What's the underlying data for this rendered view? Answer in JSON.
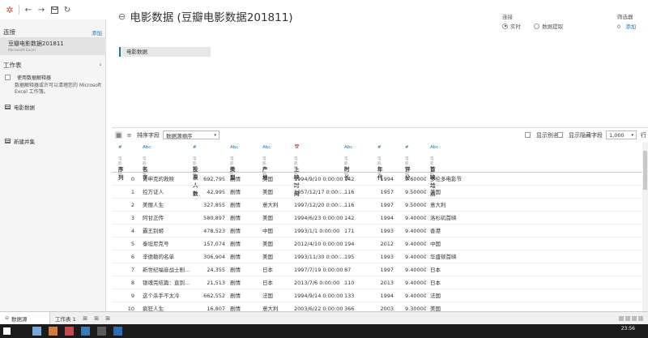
{
  "left_pane": {
    "connections_title": "连接",
    "add_link": "添加",
    "connection_name": "豆瓣电影数据201811",
    "connection_type": "Microsoft Excel",
    "sheets_title": "工作表",
    "search_icon": "search-icon",
    "interpreter_label": "使用数据解释器",
    "interpreter_note": "数据解释器或许可以清理您的 Microsoft Excel 工作簿。",
    "sheet_item": "电影数据",
    "new_union": "新建并集"
  },
  "header": {
    "title": "电影数据 (豆瓣电影数据201811)",
    "connection_label": "连接",
    "live_label": "实时",
    "extract_label": "数据提取",
    "filters_label": "筛选器",
    "filters_count": "0",
    "filters_add": "添加"
  },
  "canvas": {
    "table_name": "电影数据"
  },
  "grid_toolbar": {
    "sort_label": "排序字段",
    "sort_value": "数据源顺序",
    "show_alias_label": "显示别名",
    "show_hidden_label": "显示隐藏字段",
    "rows_value": "1,000",
    "rows_label": "行"
  },
  "grid": {
    "columns": [
      {
        "type": "#",
        "source": "电影数据",
        "name": "序列"
      },
      {
        "type": "Abc",
        "source": "电影数据",
        "name": "名字"
      },
      {
        "type": "#",
        "source": "电影数据",
        "name": "投票人数"
      },
      {
        "type": "Abc",
        "source": "电影数据",
        "name": "类型"
      },
      {
        "type": "Abc",
        "source": "电影数据",
        "name": "产地"
      },
      {
        "type": "📅",
        "source": "电影数据",
        "name": "上映时间"
      },
      {
        "type": "Abc",
        "source": "电影数据",
        "name": "时长"
      },
      {
        "type": "#",
        "source": "电影数据",
        "name": "年代"
      },
      {
        "type": "#",
        "source": "电影数据",
        "name": "评分"
      },
      {
        "type": "Abc",
        "source": "电影数据",
        "name": "首映地点"
      }
    ],
    "rows": [
      [
        "0",
        "肖申克的救赎",
        "692,795",
        "剧情",
        "美国",
        "1994/9/10 0:00:00",
        "142",
        "1994",
        "9.60000",
        "多伦多电影节"
      ],
      [
        "1",
        "控方证人",
        "42,995",
        "剧情",
        "美国",
        "1957/12/17 0:00:...",
        "116",
        "1957",
        "9.50000",
        "美国"
      ],
      [
        "2",
        "美丽人生",
        "327,855",
        "剧情",
        "意大利",
        "1997/12/20 0:00:...",
        "116",
        "1997",
        "9.50000",
        "意大利"
      ],
      [
        "3",
        "阿甘正传",
        "580,897",
        "剧情",
        "美国",
        "1994/6/23 0:00:00",
        "142",
        "1994",
        "9.40000",
        "洛杉矶首映"
      ],
      [
        "4",
        "霸王别姬",
        "478,523",
        "剧情",
        "中国",
        "1993/1/1 0:00:00",
        "171",
        "1993",
        "9.40000",
        "香港"
      ],
      [
        "5",
        "泰坦尼克号",
        "157,074",
        "剧情",
        "美国",
        "2012/4/10 0:00:00",
        "194",
        "2012",
        "9.40000",
        "中国"
      ],
      [
        "6",
        "辛德勒的名单",
        "306,904",
        "剧情",
        "美国",
        "1993/11/30 0:00:...",
        "195",
        "1993",
        "9.40000",
        "华盛顿首映"
      ],
      [
        "7",
        "新世纪福音战士剧...",
        "24,355",
        "剧情",
        "日本",
        "1997/7/19 0:00:00",
        "87",
        "1997",
        "9.40000",
        "日本"
      ],
      [
        "8",
        "银魂完结篇：直到...",
        "21,513",
        "剧情",
        "日本",
        "2013/7/6 0:00:00",
        "110",
        "2013",
        "9.40000",
        "日本"
      ],
      [
        "9",
        "这个杀手不太冷",
        "662,552",
        "剧情",
        "法国",
        "1994/9/14 0:00:00",
        "133",
        "1994",
        "9.40000",
        "法国"
      ],
      [
        "10",
        "疯狂人生",
        "16,807",
        "剧情",
        "意大利",
        "2003/6/22 0:00:00",
        "366",
        "2003",
        "9.30000",
        "美国"
      ]
    ]
  },
  "tabbar": {
    "datasource_label": "数据源",
    "sheet1_label": "工作表 1"
  },
  "taskbar": {
    "time": "23:56"
  }
}
